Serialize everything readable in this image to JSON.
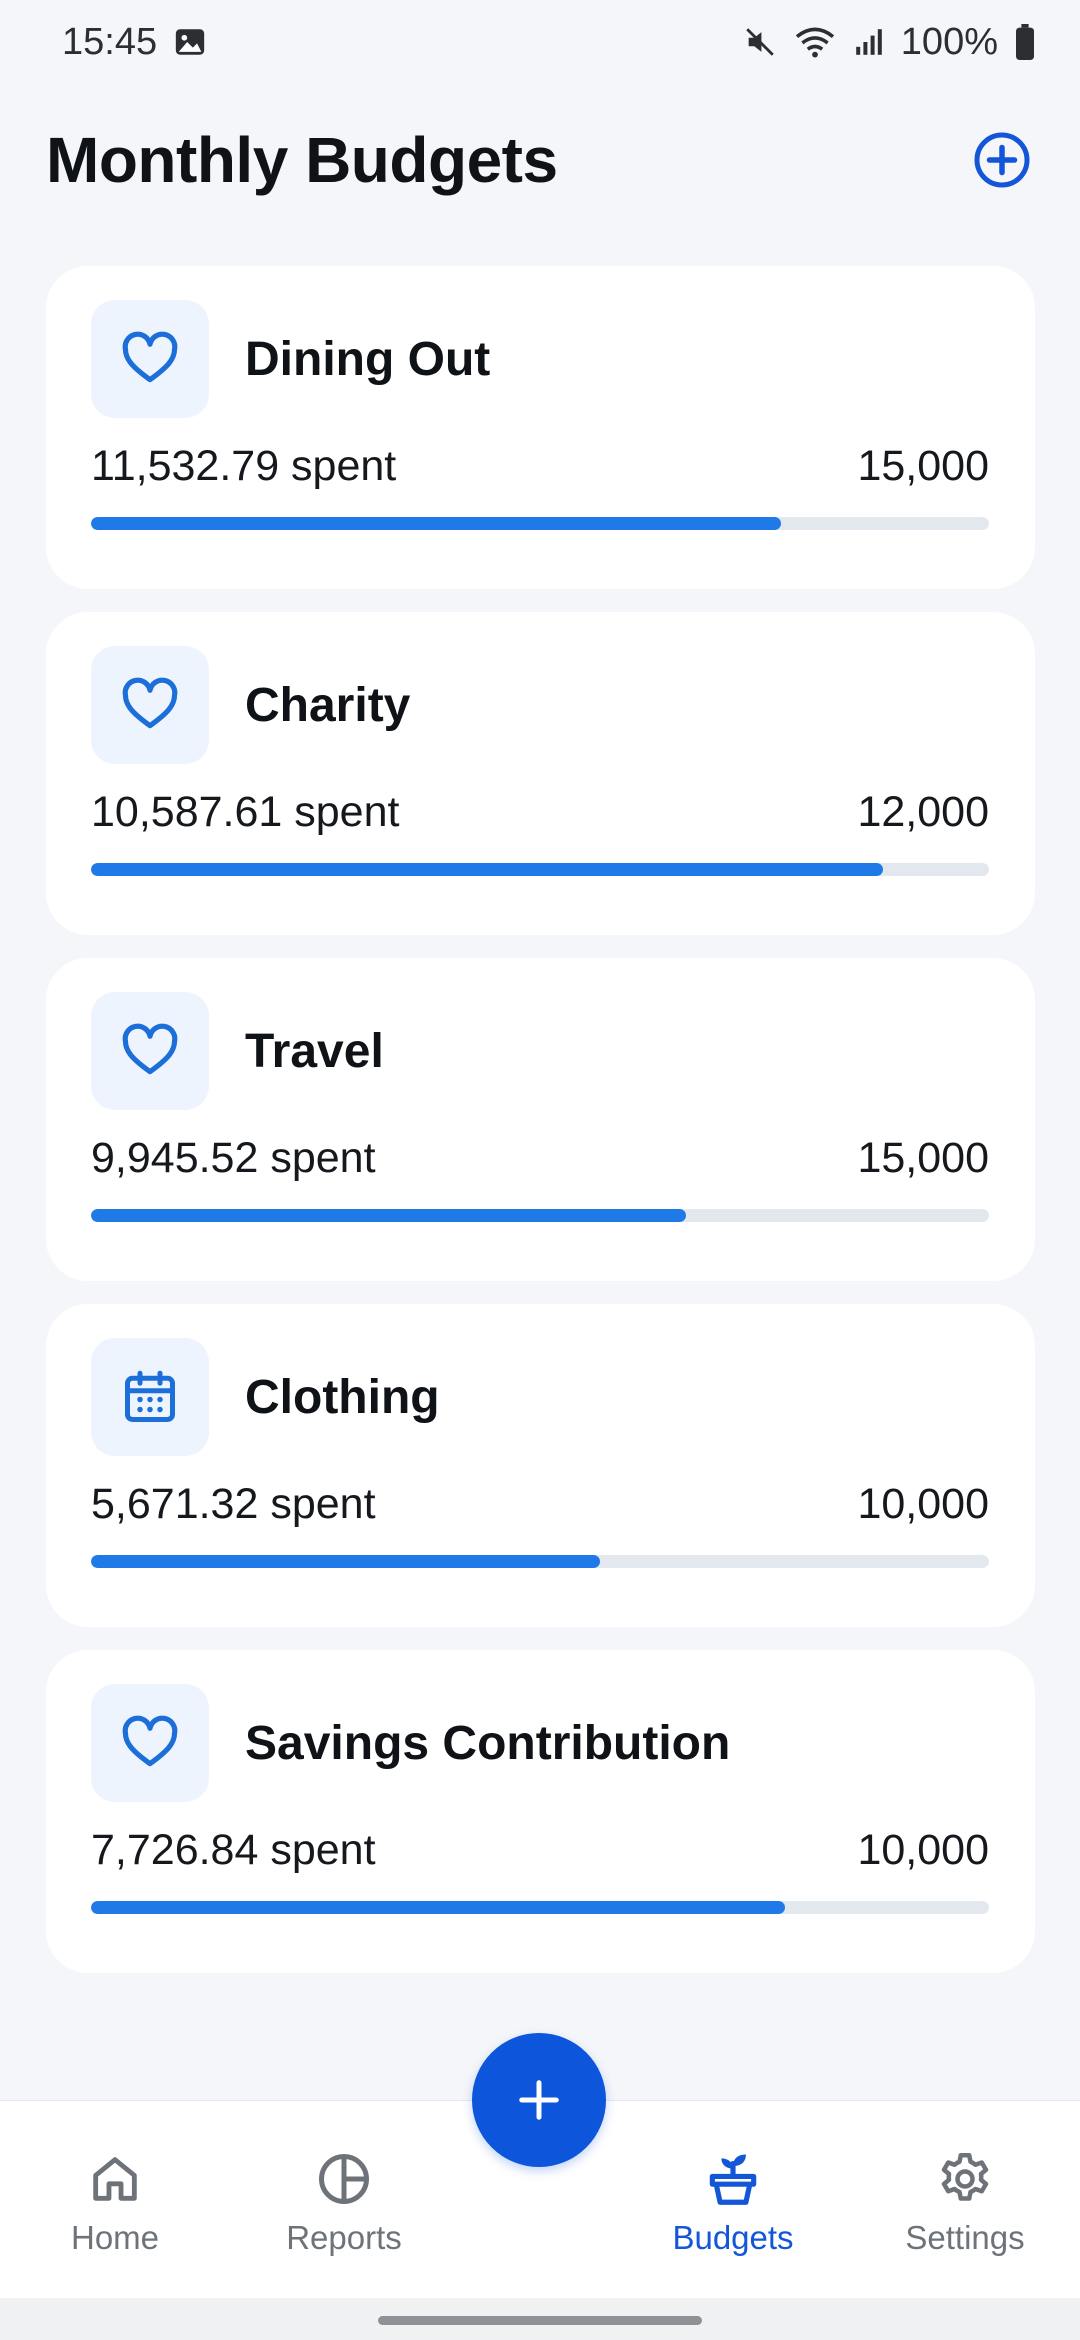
{
  "status_bar": {
    "time": "15:45",
    "battery": "100%",
    "icons": [
      "image-icon",
      "mute-icon",
      "wifi-icon",
      "signal-icon",
      "battery-icon"
    ]
  },
  "header": {
    "title": "Monthly Budgets",
    "add_icon": "add-circle-icon"
  },
  "budgets": [
    {
      "name": "Dining Out",
      "icon": "heart-icon",
      "spent": "11,532.79 spent",
      "limit": "15,000",
      "progress": 0.768
    },
    {
      "name": "Charity",
      "icon": "heart-icon",
      "spent": "10,587.61 spent",
      "limit": "12,000",
      "progress": 0.882
    },
    {
      "name": "Travel",
      "icon": "heart-icon",
      "spent": "9,945.52 spent",
      "limit": "15,000",
      "progress": 0.663
    },
    {
      "name": "Clothing",
      "icon": "calendar-icon",
      "spent": "5,671.32 spent",
      "limit": "10,000",
      "progress": 0.567
    },
    {
      "name": "Savings Contribution",
      "icon": "heart-icon",
      "spent": "7,726.84 spent",
      "limit": "10,000",
      "progress": 0.773
    }
  ],
  "nav": {
    "items": [
      {
        "label": "Home",
        "icon": "home-icon",
        "active": false
      },
      {
        "label": "Reports",
        "icon": "pie-chart-icon",
        "active": false
      },
      {
        "label": "Budgets",
        "icon": "plant-pot-icon",
        "active": true
      },
      {
        "label": "Settings",
        "icon": "gear-icon",
        "active": false
      }
    ],
    "fab_icon": "plus-icon"
  },
  "colors": {
    "accent": "#1456d8",
    "progress": "#1f7ae8",
    "track": "#e3e8ef",
    "card_icon_bg": "#eef4fd",
    "background": "#f5f6f9"
  }
}
